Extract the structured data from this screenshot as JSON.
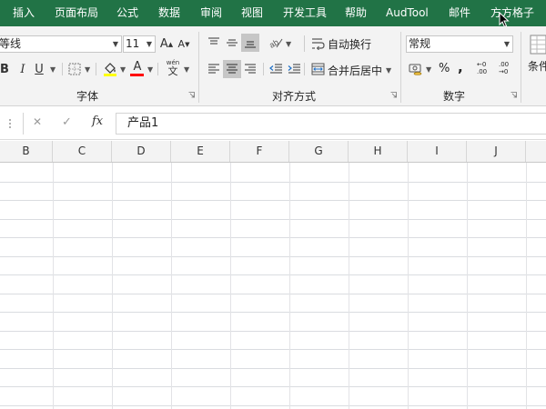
{
  "ribbon_tabs": [
    "插入",
    "页面布局",
    "公式",
    "数据",
    "审阅",
    "视图",
    "开发工具",
    "帮助",
    "AudTool",
    "邮件",
    "方方格子"
  ],
  "font_group": {
    "font_name": "等线",
    "font_size": "11",
    "grow_label": "A",
    "shrink_label": "A",
    "bold_label": "B",
    "italic_label": "I",
    "underline_label": "U",
    "font_color_label": "A",
    "phonetic_top": "wén",
    "phonetic_bottom": "文",
    "label": "字体"
  },
  "alignment_group": {
    "wrap_text_label": "自动换行",
    "merge_center_label": "合并后居中",
    "label": "对齐方式"
  },
  "number_group": {
    "format_value": "常规",
    "percent_label": "%",
    "comma_label": ",",
    "inc_decimal_label": "←0 .00",
    "dec_decimal_label": ".00 →0",
    "label": "数字"
  },
  "styles_group": {
    "conditional_label": "条件"
  },
  "formula_bar": {
    "cancel_symbol": "✕",
    "enter_symbol": "✓",
    "fx_label": "fx",
    "content": "产品1"
  },
  "columns": [
    "B",
    "C",
    "D",
    "E",
    "F",
    "G",
    "H",
    "I",
    "J"
  ],
  "colors": {
    "ribbon_green": "#217346",
    "ribbon_bg": "#f3f3f3",
    "font_color_bar": "#ff0000",
    "fill_color_bar": "#ffff00"
  }
}
